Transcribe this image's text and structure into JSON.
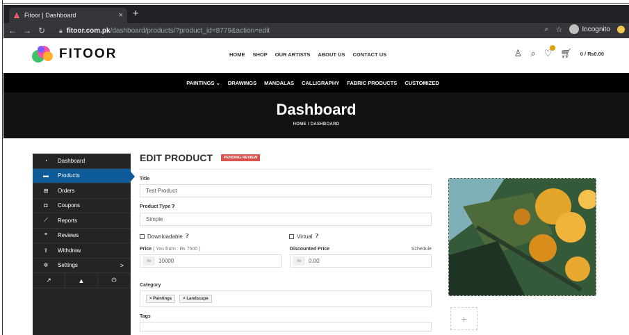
{
  "browser": {
    "tab_title": "Fitoor | Dashboard",
    "tab_close": "×",
    "new_tab": "+",
    "url_host": "fitoor.com.pk",
    "url_path": "/dashboard/products/?product_id=8779&action=edit",
    "incognito_label": "Incognito"
  },
  "site": {
    "logo_text": "FITOOR",
    "nav": [
      "HOME",
      "SHOP",
      "OUR ARTISTS",
      "ABOUT US",
      "CONTACT US"
    ],
    "cart_text": "0 / ₨0.00",
    "categories": [
      "PAINTINGS ⌄",
      "DRAWINGS",
      "MANDALAS",
      "CALLIGRAPHY",
      "FABRIC PRODUCTS",
      "CUSTOMIZED"
    ]
  },
  "hero": {
    "title": "Dashboard",
    "breadcrumb": "HOME  /  DASHBOARD"
  },
  "sidebar": {
    "items": [
      {
        "label": "Dashboard",
        "icon": "tachometer-icon"
      },
      {
        "label": "Products",
        "icon": "briefcase-icon"
      },
      {
        "label": "Orders",
        "icon": "cart-icon"
      },
      {
        "label": "Coupons",
        "icon": "gift-icon"
      },
      {
        "label": "Reports",
        "icon": "chart-icon"
      },
      {
        "label": "Reviews",
        "icon": "comments-icon"
      },
      {
        "label": "Withdraw",
        "icon": "upload-icon"
      },
      {
        "label": "Settings",
        "icon": "cog-icon"
      }
    ],
    "settings_arrow": ">"
  },
  "form": {
    "heading": "EDIT PRODUCT",
    "status_badge": "PENDING REVIEW",
    "title_label": "Title",
    "title_value": "Test Product",
    "type_label": "Product Type",
    "type_value": "Simple",
    "downloadable_label": "Downloadable",
    "virtual_label": "Virtual",
    "price_label": "Price",
    "price_hint": "( You Earn : ₨ 7500 )",
    "currency": "₨",
    "price_value": "10000",
    "discount_label": "Discounted Price",
    "schedule_label": "Schedule",
    "discount_value": "0.00",
    "category_label": "Category",
    "categories": [
      "× Paintings",
      "× Landscape"
    ],
    "tags_label": "Tags",
    "add_image": "+"
  },
  "colors": {
    "sidebar_bg": "#242424",
    "sidebar_active": "#0d5c99",
    "badge": "#d9534f",
    "hero_bg": "#121212"
  }
}
